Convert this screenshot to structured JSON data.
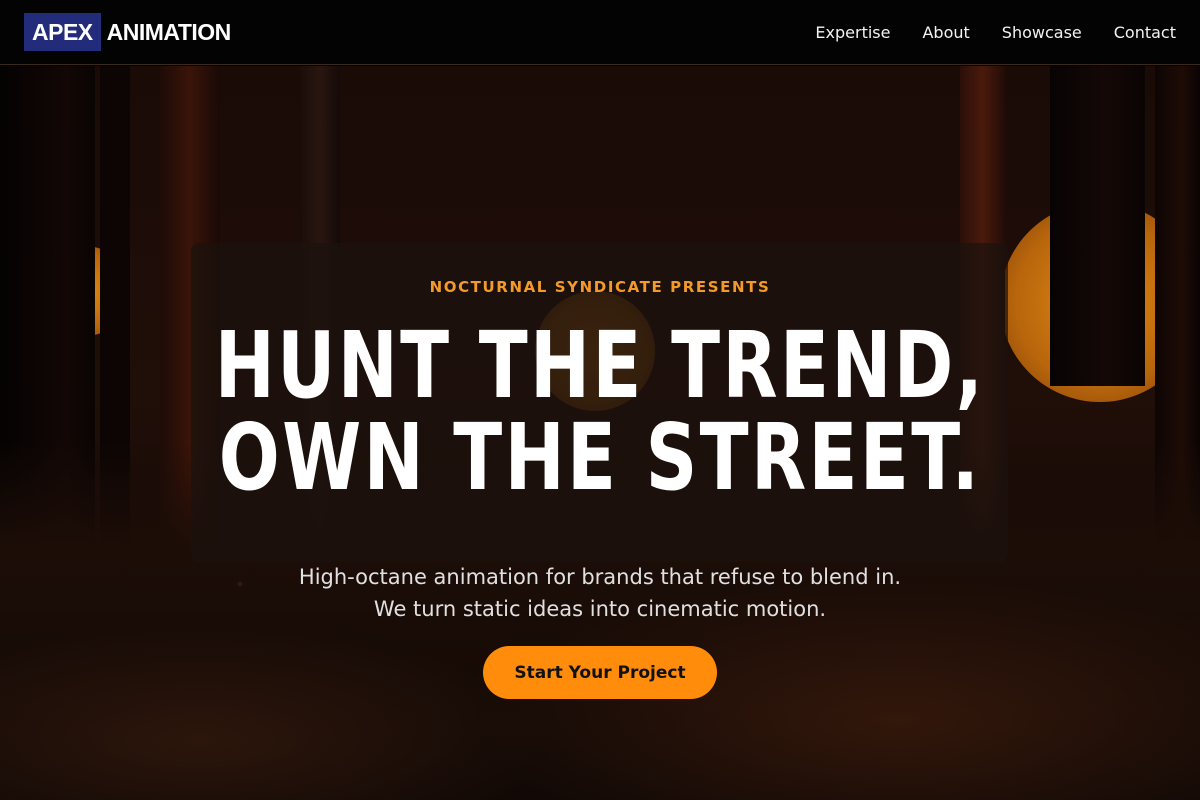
{
  "header": {
    "logo_box": "APEX",
    "logo_text": "ANIMATION",
    "nav": [
      "Expertise",
      "About",
      "Showcase",
      "Contact"
    ]
  },
  "hero": {
    "kicker": "NOCTURNAL SYNDICATE PRESENTS",
    "headline_line1": "HUNT THE TREND,",
    "headline_line2": "OWN THE STREET.",
    "sub_line1": "High-octane animation for brands that refuse to blend in.",
    "sub_line2": "We turn static ideas into cinematic motion.",
    "cta_label": "Start Your Project"
  },
  "colors": {
    "accent": "#ff8c0a",
    "kicker": "#f39a2a",
    "logo_box": "#232c7a",
    "header_bg": "#030303"
  }
}
